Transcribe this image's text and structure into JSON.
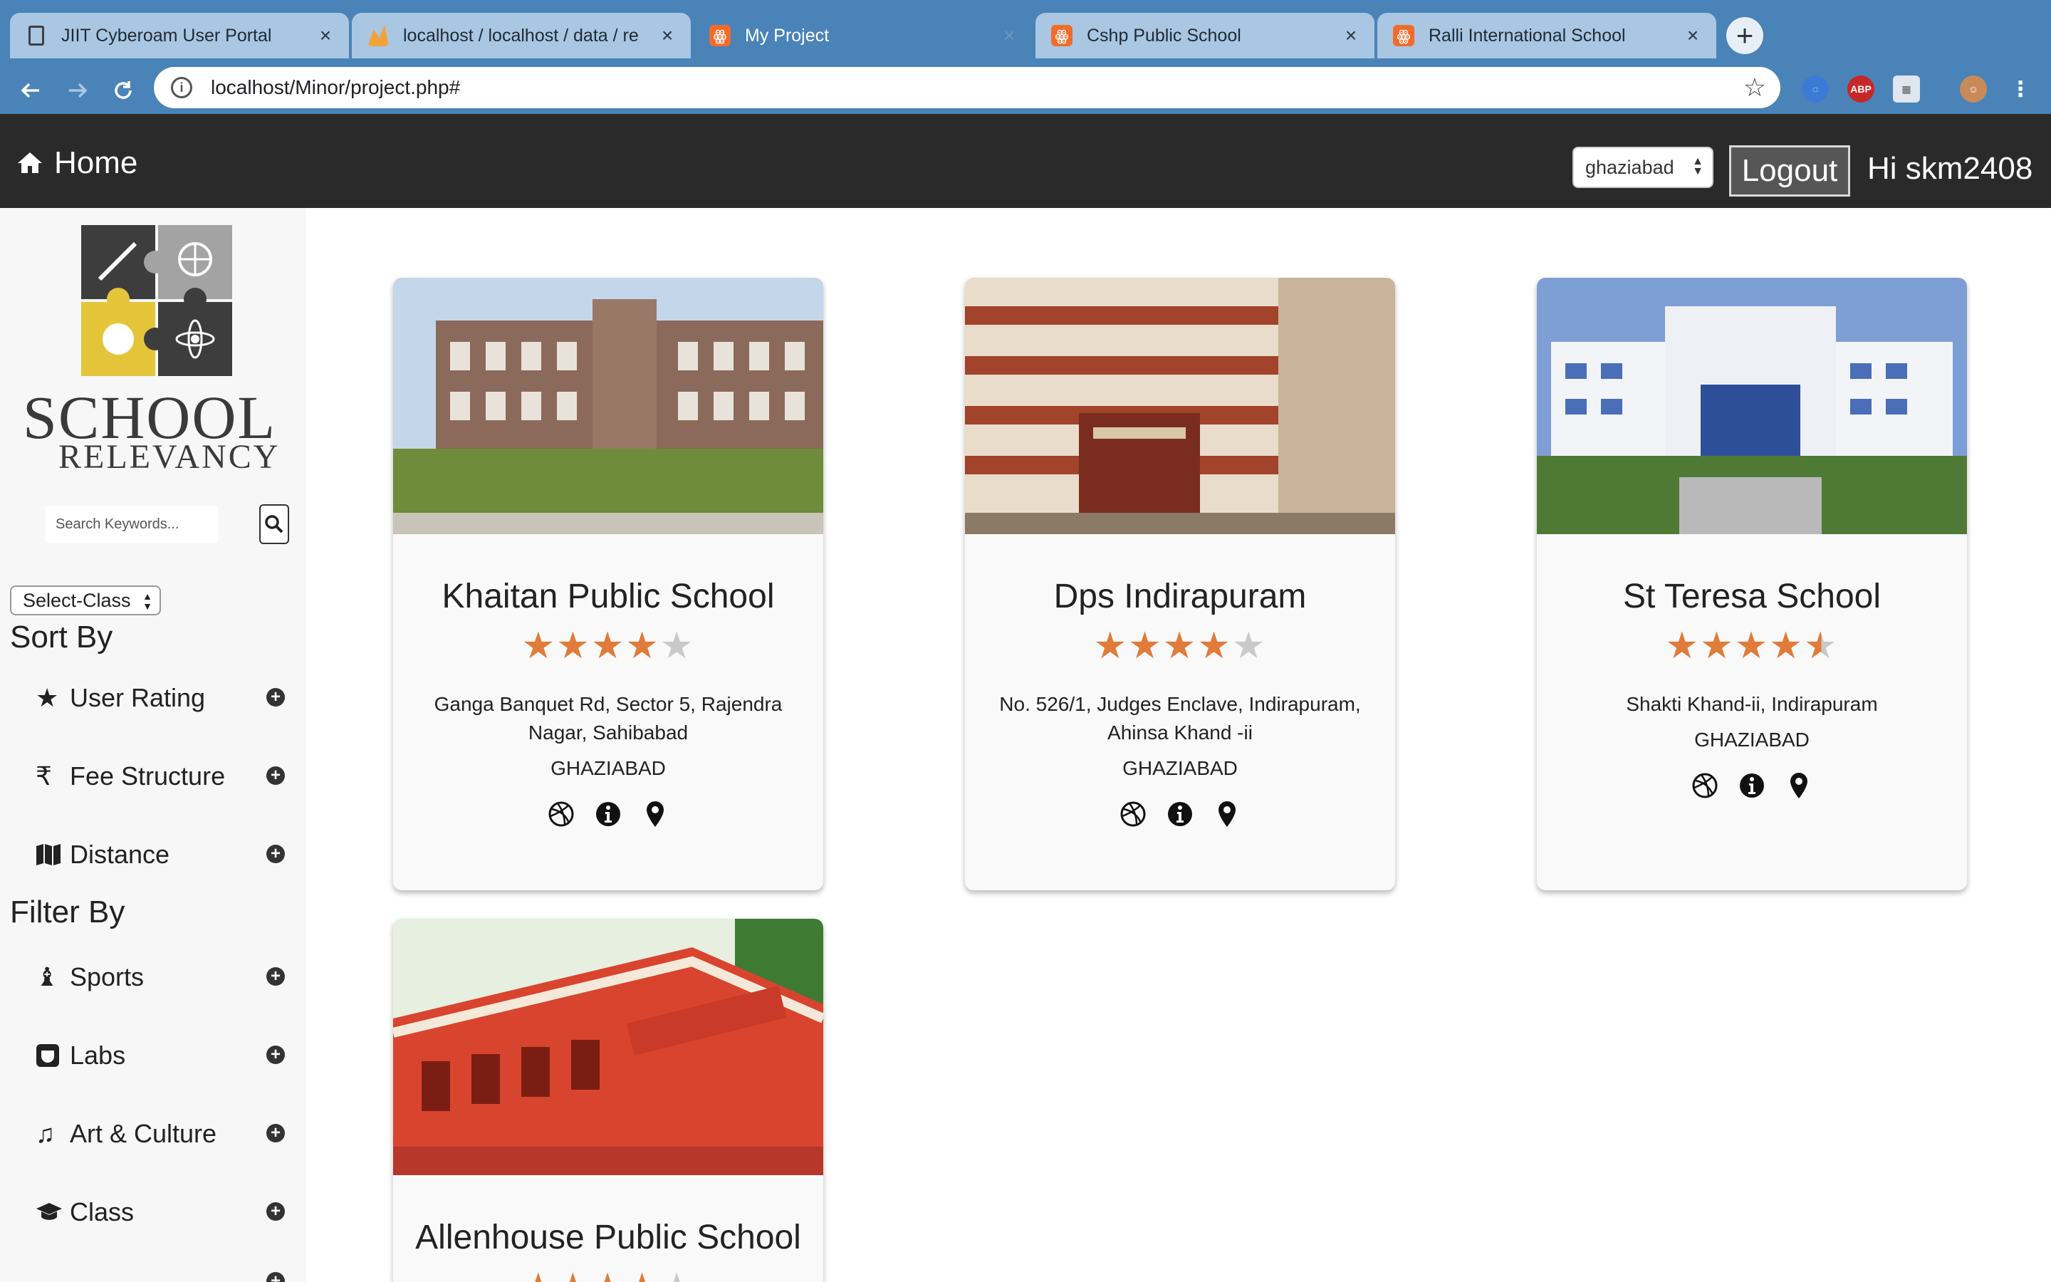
{
  "browser": {
    "tabs": [
      {
        "label": "JIIT Cyberoam User Portal",
        "icon": "document-icon"
      },
      {
        "label": "localhost / localhost / data / re",
        "icon": "phpmyadmin-icon"
      },
      {
        "label": "My Project",
        "icon": "xampp-icon"
      },
      {
        "label": "Cshp Public School",
        "icon": "xampp-icon"
      },
      {
        "label": "Ralli International School",
        "icon": "xampp-icon"
      }
    ],
    "active_tab": 2,
    "url": "localhost/Minor/project.php#",
    "extension_abp": "ABP"
  },
  "header": {
    "home_label": "Home",
    "city_selected": "ghaziabad",
    "logout_label": "Logout",
    "greeting": "Hi skm2408",
    "background": "#2a2a2a"
  },
  "sidebar": {
    "brand_line1": "SCHOOL",
    "brand_line2": "RELEVANCY",
    "search_placeholder": "Search Keywords...",
    "class_select": "Select-Class",
    "sort_title": "Sort By",
    "sort_items": [
      {
        "label": "User Rating",
        "icon": "star-icon"
      },
      {
        "label": "Fee Structure",
        "icon": "rupee-icon"
      },
      {
        "label": "Distance",
        "icon": "map-icon"
      }
    ],
    "filter_title": "Filter By",
    "filter_items": [
      {
        "label": "Sports",
        "icon": "chess-icon"
      },
      {
        "label": "Labs",
        "icon": "lab-icon"
      },
      {
        "label": "Art & Culture",
        "icon": "music-icon"
      },
      {
        "label": "Class",
        "icon": "graduation-cap-icon"
      }
    ]
  },
  "schools": [
    {
      "name": "Khaitan Public School",
      "rating": 4,
      "address": "Ganga Banquet Rd, Sector 5, Rajendra Nagar, Sahibabad",
      "city": "GHAZIABAD"
    },
    {
      "name": "Dps Indirapuram",
      "rating": 4,
      "address": "No. 526/1, Judges Enclave, Indirapuram, Ahinsa Khand -ii",
      "city": "GHAZIABAD"
    },
    {
      "name": "St Teresa School",
      "rating": 4.5,
      "address": "Shakti Khand-ii, Indirapuram",
      "city": "GHAZIABAD"
    },
    {
      "name": "Allenhouse Public School",
      "rating": 4,
      "address": "",
      "city": ""
    }
  ],
  "colors": {
    "accent_star": "#e07b39",
    "browser": "#4a83b8"
  }
}
